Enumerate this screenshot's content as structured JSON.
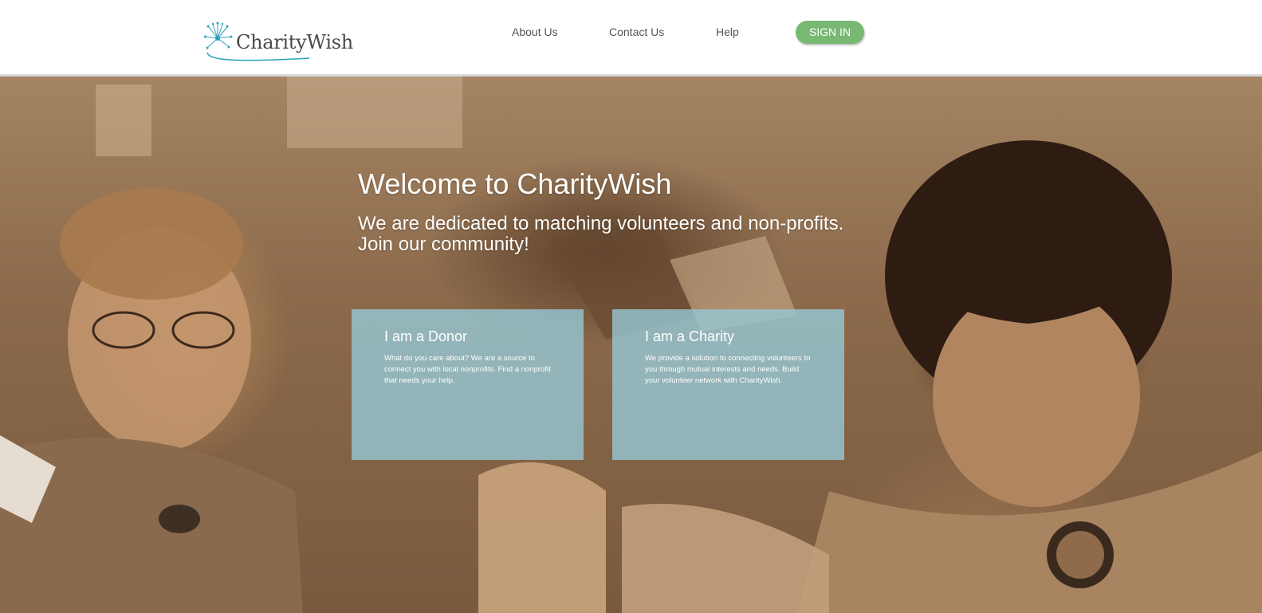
{
  "brand": {
    "logo_text": "CharityWish",
    "accent_color": "#2aa3b8"
  },
  "nav": {
    "about": "About Us",
    "contact": "Contact Us",
    "help": "Help",
    "signin": "SIGN IN",
    "signin_color": "#79b873"
  },
  "hero": {
    "title": "Welcome to CharityWish",
    "subtitle_line1": "We are dedicated to matching volunteers and non-profits.",
    "subtitle_line2": "Join our community!"
  },
  "cards": [
    {
      "title": "I am a Donor",
      "text": "What do you care about? We are a source to connect you with local nonprofits. Find a nonprofit that needs your help."
    },
    {
      "title": "I am a Charity",
      "text": "We provide a solution to connecting volunteers to you through mutual interests and needs. Build your volunteer network with CharityWish."
    }
  ],
  "colors": {
    "card_bg": "#96c8d4"
  }
}
